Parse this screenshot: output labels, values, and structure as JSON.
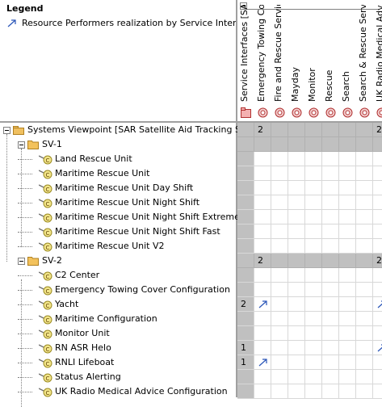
{
  "legend": {
    "title": "Legend",
    "items": [
      {
        "label": "Resource Performers realization by Service Interfa...",
        "icon": "realization-arrow-icon"
      }
    ]
  },
  "columns": [
    {
      "label": "Service Interfaces [SAI",
      "icon": "package-icon"
    },
    {
      "label": "Emergency Towing Co-",
      "icon": "service-interface-icon"
    },
    {
      "label": "Fire and Rescue Servic-",
      "icon": "service-interface-icon"
    },
    {
      "label": "Mayday",
      "icon": "service-interface-icon"
    },
    {
      "label": "Monitor",
      "icon": "service-interface-icon"
    },
    {
      "label": "Rescue",
      "icon": "service-interface-icon"
    },
    {
      "label": "Search",
      "icon": "service-interface-icon"
    },
    {
      "label": "Search & Rescue Servi-",
      "icon": "service-interface-icon"
    },
    {
      "label": "UK Radio Medical Advic",
      "icon": "service-interface-icon"
    }
  ],
  "rows": [
    {
      "label": "Systems Viewpoint [SAR Satellite Aid Tracking System]",
      "level": 0,
      "type": "package",
      "expanded": true,
      "cells": [
        "",
        "2",
        "",
        "",
        "",
        "",
        "",
        "",
        "2"
      ],
      "gray": true
    },
    {
      "label": "SV-1",
      "level": 1,
      "type": "folder",
      "expanded": true,
      "cells": [
        "",
        "",
        "",
        "",
        "",
        "",
        "",
        "",
        ""
      ],
      "gray": true
    },
    {
      "label": "Land Rescue Unit",
      "level": 2,
      "type": "element",
      "cells": [
        "",
        "",
        "",
        "",
        "",
        "",
        "",
        "",
        ""
      ]
    },
    {
      "label": "Maritime Rescue Unit",
      "level": 2,
      "type": "element",
      "cells": [
        "",
        "",
        "",
        "",
        "",
        "",
        "",
        "",
        ""
      ]
    },
    {
      "label": "Maritime Rescue Unit Day Shift",
      "level": 2,
      "type": "element",
      "cells": [
        "",
        "",
        "",
        "",
        "",
        "",
        "",
        "",
        ""
      ]
    },
    {
      "label": "Maritime Rescue Unit Night Shift",
      "level": 2,
      "type": "element",
      "cells": [
        "",
        "",
        "",
        "",
        "",
        "",
        "",
        "",
        ""
      ]
    },
    {
      "label": "Maritime Rescue Unit Night Shift Extreme",
      "level": 2,
      "type": "element",
      "cells": [
        "",
        "",
        "",
        "",
        "",
        "",
        "",
        "",
        ""
      ]
    },
    {
      "label": "Maritime Rescue Unit Night Shift Fast",
      "level": 2,
      "type": "element",
      "cells": [
        "",
        "",
        "",
        "",
        "",
        "",
        "",
        "",
        ""
      ]
    },
    {
      "label": "Maritime Rescue Unit V2",
      "level": 2,
      "type": "element",
      "cells": [
        "",
        "",
        "",
        "",
        "",
        "",
        "",
        "",
        ""
      ]
    },
    {
      "label": "SV-2",
      "level": 1,
      "type": "folder",
      "expanded": true,
      "cells": [
        "",
        "2",
        "",
        "",
        "",
        "",
        "",
        "",
        "2"
      ],
      "gray": true
    },
    {
      "label": "C2 Center",
      "level": 2,
      "type": "element",
      "cells": [
        "",
        "",
        "",
        "",
        "",
        "",
        "",
        "",
        ""
      ]
    },
    {
      "label": "Emergency Towing Cover Configuration",
      "level": 2,
      "type": "element",
      "cells": [
        "",
        "",
        "",
        "",
        "",
        "",
        "",
        "",
        ""
      ]
    },
    {
      "label": "Yacht",
      "level": 2,
      "type": "element",
      "cells": [
        "2",
        "arrow",
        "",
        "",
        "",
        "",
        "",
        "",
        "arrow"
      ]
    },
    {
      "label": "Maritime Configuration",
      "level": 2,
      "type": "element",
      "cells": [
        "",
        "",
        "",
        "",
        "",
        "",
        "",
        "",
        ""
      ]
    },
    {
      "label": "Monitor Unit",
      "level": 2,
      "type": "element",
      "cells": [
        "",
        "",
        "",
        "",
        "",
        "",
        "",
        "",
        ""
      ]
    },
    {
      "label": "RN ASR Helo",
      "level": 2,
      "type": "element",
      "cells": [
        "1",
        "",
        "",
        "",
        "",
        "",
        "",
        "",
        "arrow"
      ]
    },
    {
      "label": "RNLI Lifeboat",
      "level": 2,
      "type": "element",
      "cells": [
        "1",
        "arrow",
        "",
        "",
        "",
        "",
        "",
        "",
        ""
      ]
    },
    {
      "label": "Status Alerting",
      "level": 2,
      "type": "element",
      "cells": [
        "",
        "",
        "",
        "",
        "",
        "",
        "",
        "",
        ""
      ]
    },
    {
      "label": "UK Radio Medical Advice Configuration",
      "level": 2,
      "type": "element",
      "cells": [
        "",
        "",
        "",
        "",
        "",
        "",
        "",
        "",
        ""
      ]
    }
  ],
  "colors": {
    "gray_cell": "#c0c0c0",
    "arrow": "#2a55b8",
    "folder": "#e8b84a",
    "element": "#d8c040"
  }
}
